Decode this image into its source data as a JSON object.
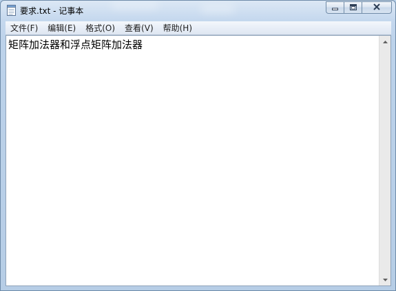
{
  "window": {
    "title": "要求.txt - 记事本",
    "icon": "notepad-icon"
  },
  "caption_buttons": {
    "minimize": "minimize-icon",
    "maximize": "maximize-icon",
    "close": "close-icon"
  },
  "menu": {
    "items": [
      {
        "label": "文件(F)"
      },
      {
        "label": "编辑(E)"
      },
      {
        "label": "格式(O)"
      },
      {
        "label": "查看(V)"
      },
      {
        "label": "帮助(H)"
      }
    ]
  },
  "editor": {
    "content": "矩阵加法器和浮点矩阵加法器"
  },
  "scrollbar": {
    "up_icon": "scroll-up-arrow-icon",
    "down_icon": "scroll-down-arrow-icon"
  }
}
